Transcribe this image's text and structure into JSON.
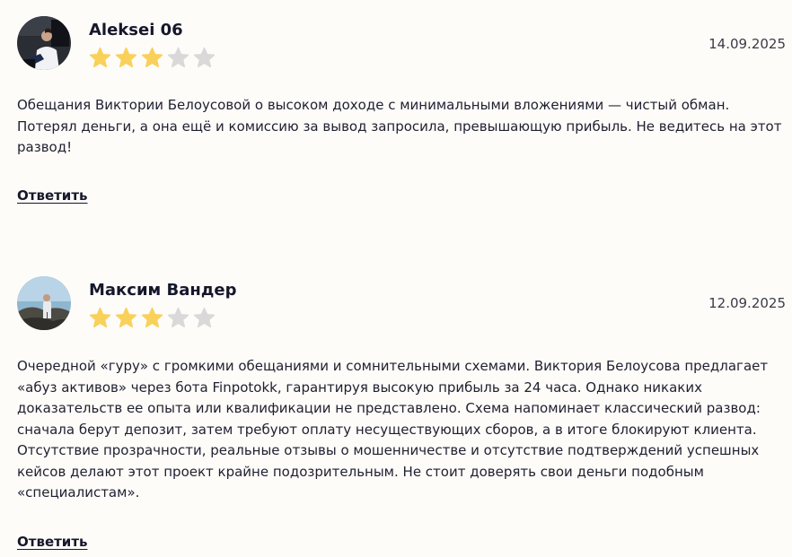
{
  "reviews": [
    {
      "author": "Aleksei 06",
      "date": "14.09.2025",
      "rating": 3,
      "rating_max": 5,
      "text": "Обещания Виктории Белоусовой о высоком доходе с минимальными вложениями — чистый обман. Потерял деньги, а она ещё и комиссию за вывод запросила, превышающую прибыль. Не ведитесь на этот развод!",
      "reply_label": "Ответить"
    },
    {
      "author": "Максим Вандер",
      "date": "12.09.2025",
      "rating": 3,
      "rating_max": 5,
      "text": "Очередной «гуру» с громкими обещаниями и сомнительными схемами. Виктория Белоусова предлагает «абуз активов» через бота Finpotokk, гарантируя высокую прибыль за 24 часа. Однако никаких доказательств ее опыта или квалификации не представлено. Схема напоминает классический развод: сначала берут депозит, затем требуют оплату несуществующих сборов, а в итоге блокируют клиента. Отсутствие прозрачности, реальные отзывы о мошенничестве и отсутствие подтверждений успешных кейсов делают этот проект крайне подозрительным. Не стоит доверять свои деньги подобным «специалистам».",
      "reply_label": "Ответить"
    }
  ],
  "colors": {
    "star_filled": "#f9d15a",
    "star_empty": "#d9d9d9",
    "background": "#fefcf9",
    "text": "#1f2030"
  }
}
